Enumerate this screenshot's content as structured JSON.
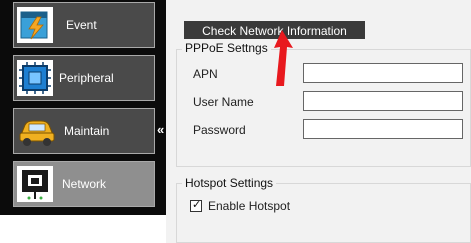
{
  "sidebar": {
    "items": [
      {
        "label": "Event",
        "icon": "event-icon"
      },
      {
        "label": "Peripheral",
        "icon": "peripheral-icon"
      },
      {
        "label": "Maintain",
        "icon": "maintain-icon"
      },
      {
        "label": "Network",
        "icon": "network-icon"
      }
    ],
    "collapse_glyph": "«"
  },
  "toolbar": {
    "check_network_label": "Check Network Information"
  },
  "pppoe": {
    "title": "PPPoE Settngs",
    "apn_label": "APN",
    "username_label": "User Name",
    "password_label": "Password",
    "apn_value": "",
    "username_value": "",
    "password_value": ""
  },
  "hotspot": {
    "title": "Hotspot Settings",
    "enable_label": "Enable Hotspot",
    "enabled": true
  },
  "colors": {
    "sidebar_bg": "#0b0b0b",
    "active_item": "#8f8f8f",
    "arrow": "#e8191e"
  }
}
